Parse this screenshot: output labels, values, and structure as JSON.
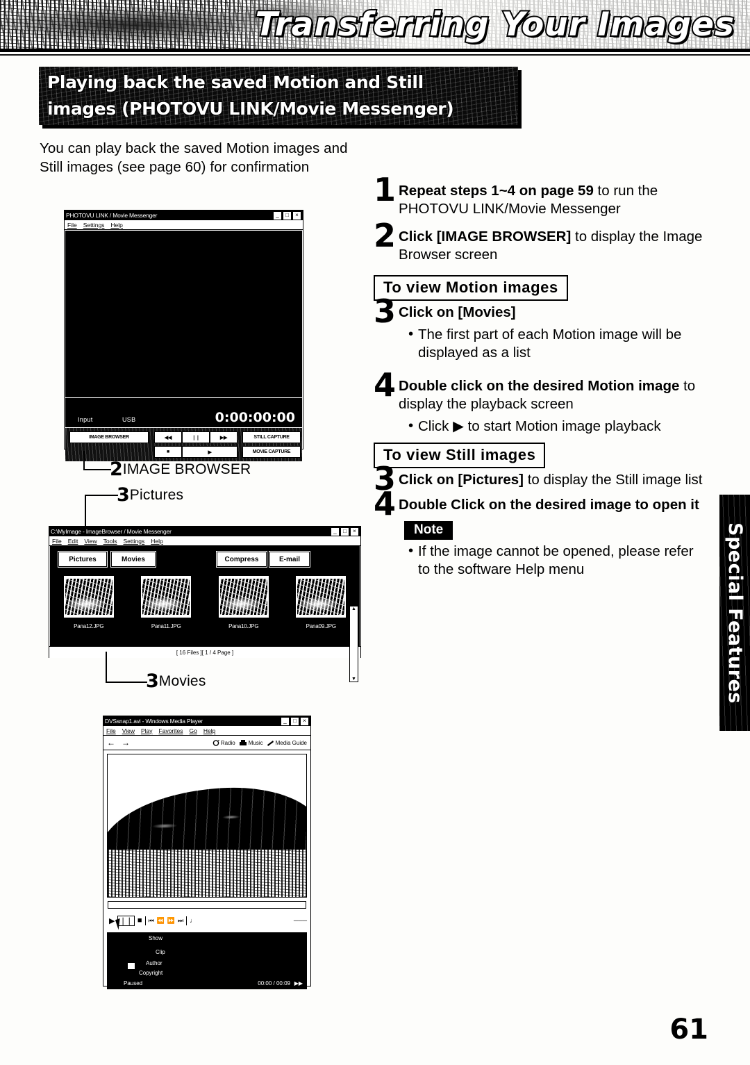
{
  "header": {
    "title": "Transferring Your Images"
  },
  "banner": {
    "line1": "Playing back the saved Motion and Still",
    "line2": "images (PHOTOVU LINK/Movie Messenger)"
  },
  "intro": "You can play back the saved Motion images and Still images (see page 60) for confirmation",
  "steps": {
    "s1": {
      "num": "1",
      "bold": "Repeat steps 1~4 on page 59",
      "rest": " to run the PHOTOVU LINK/Movie Messenger"
    },
    "s2": {
      "num": "2",
      "bold": "Click [IMAGE BROWSER]",
      "rest": " to display the Image Browser screen"
    },
    "motion_head": "To view Motion images",
    "s3": {
      "num": "3",
      "bold": "Click on [Movies]",
      "rest": ""
    },
    "s3_bullet": "The first part of each Motion image will be displayed as a list",
    "s4": {
      "num": "4",
      "bold": "Double click on the desired Motion image",
      "rest": " to display the playback screen"
    },
    "s4_bullet_a": "Click ",
    "s4_bullet_b": " to start Motion image playback",
    "still_head": "To view Still images",
    "s5": {
      "num": "3",
      "bold": "Click on [Pictures]",
      "rest": " to display the Still image list"
    },
    "s6": {
      "num": "4",
      "bold": "Double Click on the desired image to open it",
      "rest": ""
    },
    "note_label": "Note",
    "note_bullet": "If the image cannot be opened, please refer to the software Help menu"
  },
  "callouts": {
    "c2_num": "2",
    "c2_label": "IMAGE BROWSER",
    "c3a_num": "3",
    "c3a_label": "Pictures",
    "c3b_num": "3",
    "c3b_label": "Movies"
  },
  "shot1": {
    "title": "PHOTOVU LINK / Movie Messenger",
    "min": "_",
    "max": "□",
    "close": "×",
    "menus": [
      "File",
      "Settings",
      "Help"
    ],
    "input_label": "Input",
    "input_value": "USB",
    "timecode": "0:00:00:00",
    "buttons": {
      "image_browser": "IMAGE BROWSER",
      "rew": "◀◀",
      "pause": "❘❘",
      "ff": "▶▶",
      "stop": "■",
      "play": "▶",
      "still_capture": "STILL CAPTURE",
      "movie_capture": "MOVIE CAPTURE"
    }
  },
  "shot2": {
    "title": "C:\\MyImage - ImageBrowser / Movie Messenger",
    "min": "_",
    "max": "□",
    "close": "×",
    "menus": [
      "File",
      "Edit",
      "View",
      "Tools",
      "Settings",
      "Help"
    ],
    "tabs": {
      "pictures": "Pictures",
      "movies": "Movies"
    },
    "actions": {
      "compress": "Compress",
      "email": "E-mail"
    },
    "thumbnails": [
      {
        "name": "Pana12.JPG"
      },
      {
        "name": "Pana11.JPG"
      },
      {
        "name": "Pana10.JPG"
      },
      {
        "name": "Pana09.JPG"
      }
    ],
    "statusbar": "[ 16 Files ][ 1 / 4 Page ]",
    "scroll_up": "▲",
    "scroll_down": "▼"
  },
  "shot3": {
    "title": "DVSsnap1.avi - Windows Media Player",
    "min": "_",
    "max": "□",
    "close": "×",
    "menus": [
      "File",
      "View",
      "Play",
      "Favorites",
      "Go",
      "Help"
    ],
    "back": "←",
    "forward": "→",
    "toolbar": [
      {
        "icon": "radio-icon",
        "label": "Radio"
      },
      {
        "icon": "music-icon",
        "label": "Music"
      },
      {
        "icon": "media-guide-icon",
        "label": "Media Guide"
      }
    ],
    "transport": {
      "play": "▶",
      "pause": "❘❘",
      "stop": "■",
      "prev": "⏮",
      "rew": "⏪",
      "ff": "⏩",
      "next": "⏭",
      "mute": "♩",
      "volume": "───"
    },
    "info": {
      "show": "Show",
      "clip": "Clip",
      "author": "Author",
      "copyright": "Copyright",
      "status": "Paused",
      "time": "00:00 / 00:09",
      "more": "▶▶"
    }
  },
  "side_tab": "Special Features",
  "page_number": "61"
}
